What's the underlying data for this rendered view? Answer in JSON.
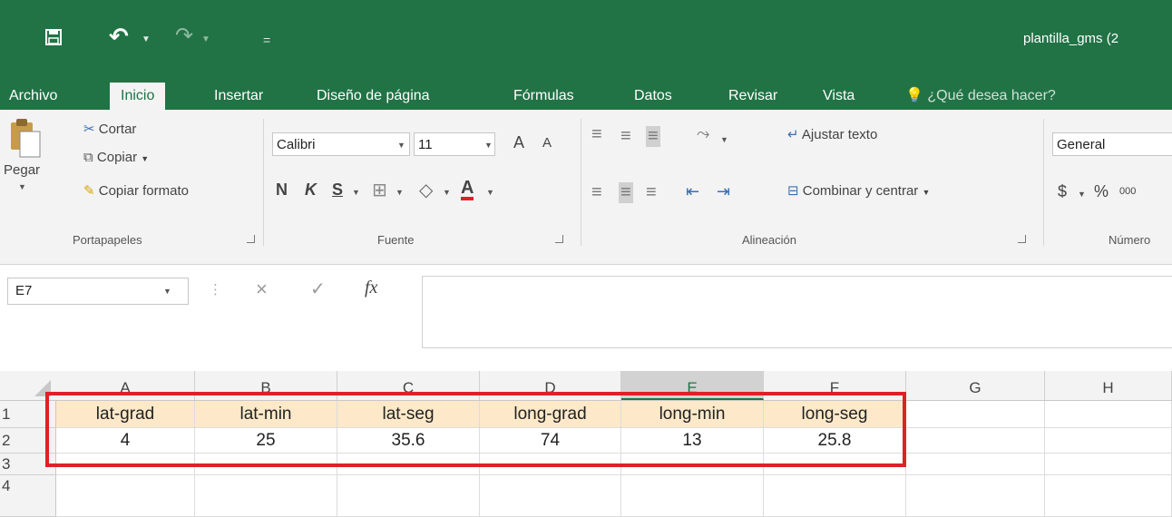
{
  "title_bar": {
    "document_title": "plantilla_gms (2",
    "save_icon": "save-icon",
    "undo_icon": "undo-icon",
    "redo_icon": "redo-icon",
    "customize_icon": "customize-qat-icon",
    "background": "#217346"
  },
  "tabs": [
    {
      "label": "Archivo"
    },
    {
      "label": "Inicio",
      "active": true
    },
    {
      "label": "Insertar"
    },
    {
      "label": "Diseño de página"
    },
    {
      "label": "Fórmulas"
    },
    {
      "label": "Datos"
    },
    {
      "label": "Revisar"
    },
    {
      "label": "Vista"
    }
  ],
  "tell_me": "¿Qué desea hacer?",
  "ribbon": {
    "clipboard": {
      "paste": "Pegar",
      "cut": "Cortar",
      "copy": "Copiar",
      "format_painter": "Copiar formato",
      "group_label": "Portapapeles"
    },
    "font": {
      "font_name": "Calibri",
      "font_size": "11",
      "bold": "N",
      "italic": "K",
      "underline": "S",
      "grow": "A",
      "shrink": "A",
      "font_color": "A",
      "group_label": "Fuente"
    },
    "alignment": {
      "wrap_text": "Ajustar texto",
      "merge_center": "Combinar y centrar",
      "group_label": "Alineación"
    },
    "number": {
      "format": "General",
      "currency": "$",
      "percent": "%",
      "thousands": "000",
      "group_label": "Número"
    }
  },
  "formula_bar": {
    "name_box": "E7",
    "cancel": "×",
    "enter": "✓",
    "fx": "fx",
    "value": ""
  },
  "sheet": {
    "columns": [
      "A",
      "B",
      "C",
      "D",
      "E",
      "F",
      "G",
      "H"
    ],
    "selected_column": "E",
    "rows": [
      "1",
      "2",
      "3",
      "4"
    ],
    "data": [
      [
        "lat-grad",
        "lat-min",
        "lat-seg",
        "long-grad",
        "long-min",
        "long-seg"
      ],
      [
        "4",
        "25",
        "35.6",
        "74",
        "13",
        "25.8"
      ]
    ],
    "highlight_color": "#e02027",
    "header_fill": "#fde9c9"
  }
}
